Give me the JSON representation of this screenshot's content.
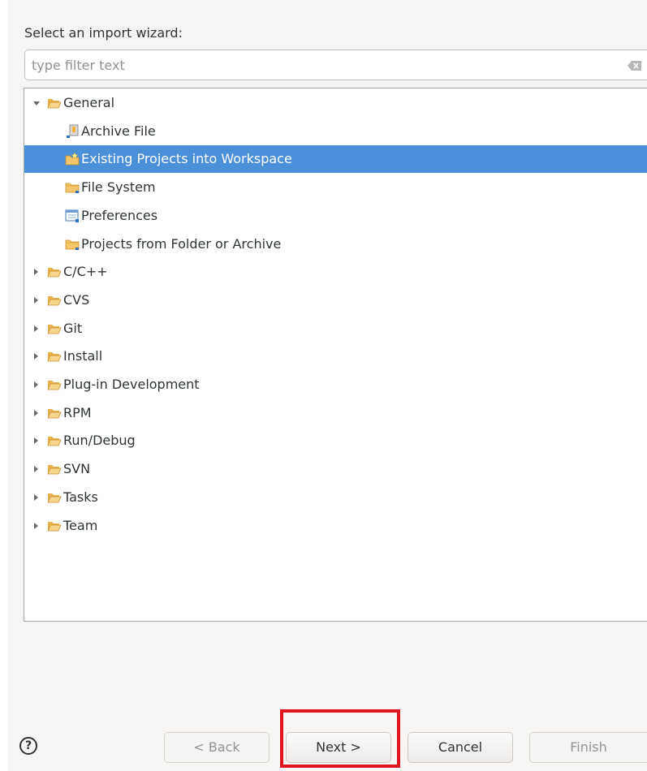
{
  "wizard": {
    "prompt": "Select an import wizard:",
    "filter": {
      "value": "",
      "placeholder": "type filter text"
    }
  },
  "tree": {
    "items": [
      {
        "label": "General",
        "level": 0,
        "expanded": true,
        "icon": "folder-open-icon"
      },
      {
        "label": "Archive File",
        "level": 1,
        "icon": "archive-file-icon"
      },
      {
        "label": "Existing Projects into Workspace",
        "level": 1,
        "icon": "existing-projects-icon",
        "selected": true
      },
      {
        "label": "File System",
        "level": 1,
        "icon": "folder-icon"
      },
      {
        "label": "Preferences",
        "level": 1,
        "icon": "preferences-icon"
      },
      {
        "label": "Projects from Folder or Archive",
        "level": 1,
        "icon": "folder-icon"
      },
      {
        "label": "C/C++",
        "level": 0,
        "expanded": false,
        "icon": "folder-open-icon"
      },
      {
        "label": "CVS",
        "level": 0,
        "expanded": false,
        "icon": "folder-open-icon"
      },
      {
        "label": "Git",
        "level": 0,
        "expanded": false,
        "icon": "folder-open-icon"
      },
      {
        "label": "Install",
        "level": 0,
        "expanded": false,
        "icon": "folder-open-icon"
      },
      {
        "label": "Plug-in Development",
        "level": 0,
        "expanded": false,
        "icon": "folder-open-icon"
      },
      {
        "label": "RPM",
        "level": 0,
        "expanded": false,
        "icon": "folder-open-icon"
      },
      {
        "label": "Run/Debug",
        "level": 0,
        "expanded": false,
        "icon": "folder-open-icon"
      },
      {
        "label": "SVN",
        "level": 0,
        "expanded": false,
        "icon": "folder-open-icon"
      },
      {
        "label": "Tasks",
        "level": 0,
        "expanded": false,
        "icon": "folder-open-icon"
      },
      {
        "label": "Team",
        "level": 0,
        "expanded": false,
        "icon": "folder-open-icon"
      }
    ]
  },
  "footer": {
    "help_label": "?",
    "back_label": "< Back",
    "next_label": "Next >",
    "cancel_label": "Cancel",
    "finish_label": "Finish"
  },
  "colors": {
    "selection": "#4a90d9",
    "highlight_box": "#e0141e",
    "folder": "#f5c56b"
  }
}
